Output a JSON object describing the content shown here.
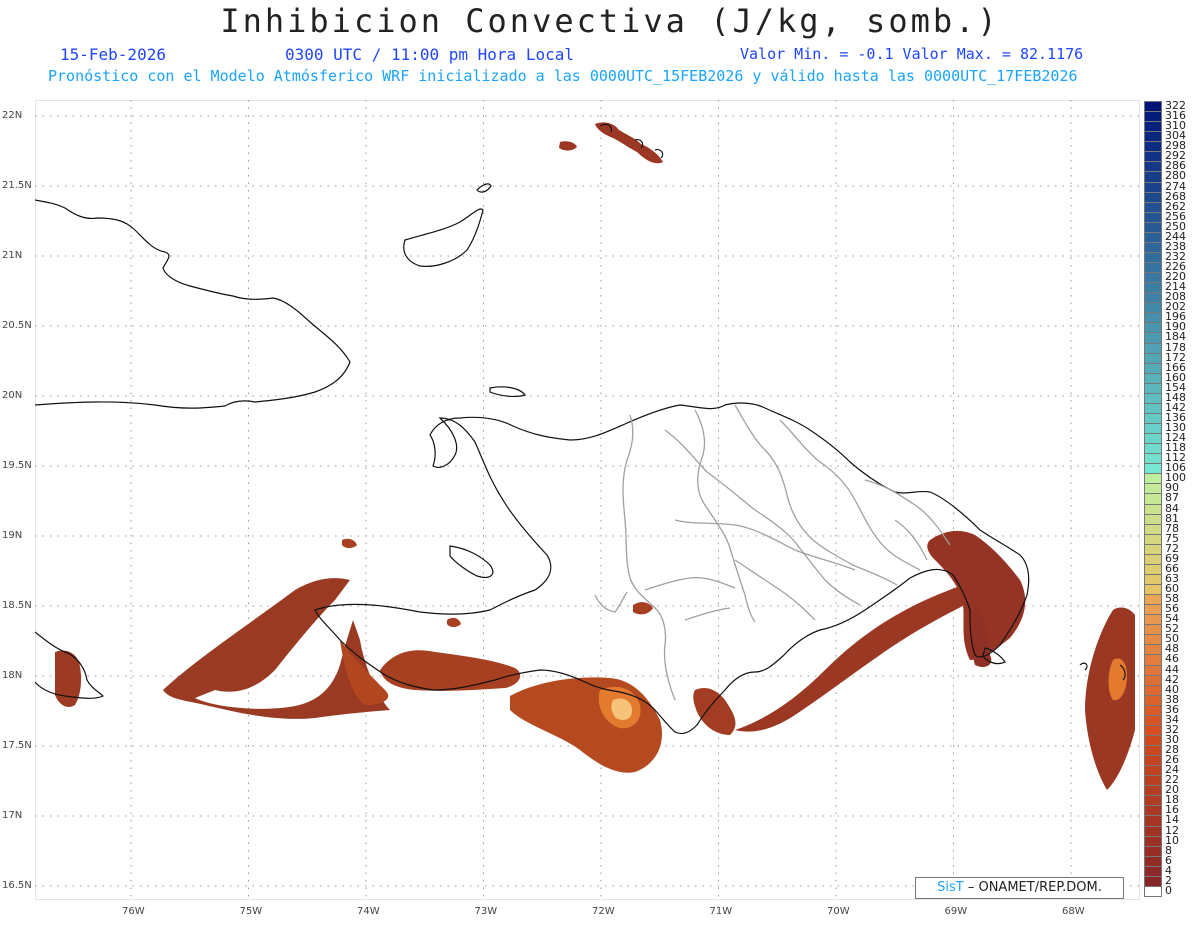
{
  "header": {
    "title": "Inhibicion Convectiva (J/kg, somb.)",
    "date": "15-Feb-2026",
    "time": "0300 UTC / 11:00 pm Hora Local",
    "minmax": "Valor Min. = -0.1  Valor Max. = 82.1176",
    "forecast_note": "Pronóstico con el Modelo Atmósferico WRF inicializado a las 0000UTC_15FEB2026 y válido hasta las  0000UTC_17FEB2026"
  },
  "map": {
    "lon_labels": [
      "76W",
      "75W",
      "74W",
      "73W",
      "72W",
      "71W",
      "70W",
      "69W",
      "68W"
    ],
    "lat_labels": [
      "22N",
      "21.5N",
      "21N",
      "20.5N",
      "20N",
      "19.5N",
      "19N",
      "18.5N",
      "18N",
      "17.5N",
      "17N",
      "16.5N"
    ],
    "shading_colors": {
      "low": "#8b2c22",
      "mid": "#c2461e",
      "high": "#f7c27a"
    }
  },
  "legend": {
    "labels": [
      "322",
      "316",
      "310",
      "304",
      "298",
      "292",
      "286",
      "280",
      "274",
      "268",
      "262",
      "256",
      "250",
      "244",
      "238",
      "232",
      "226",
      "220",
      "214",
      "208",
      "202",
      "196",
      "190",
      "184",
      "178",
      "172",
      "166",
      "160",
      "154",
      "148",
      "142",
      "136",
      "130",
      "124",
      "118",
      "112",
      "106",
      "100",
      "90",
      "87",
      "84",
      "81",
      "78",
      "75",
      "72",
      "69",
      "66",
      "63",
      "60",
      "58",
      "56",
      "54",
      "52",
      "50",
      "48",
      "46",
      "44",
      "42",
      "40",
      "38",
      "36",
      "34",
      "32",
      "30",
      "28",
      "26",
      "24",
      "22",
      "20",
      "18",
      "16",
      "14",
      "12",
      "10",
      "8",
      "6",
      "4",
      "2",
      "0"
    ]
  },
  "credit": {
    "brand": "SisT",
    "text": "– ONAMET/REP.DOM."
  }
}
